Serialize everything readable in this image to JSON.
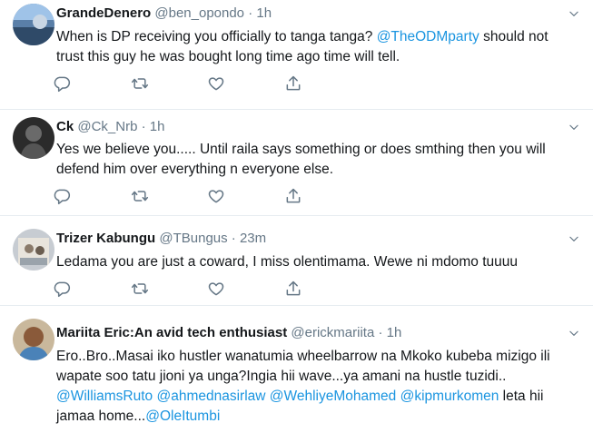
{
  "tweets": [
    {
      "name": "GrandeDenero",
      "handle": "@ben_opondo",
      "dot": "·",
      "time": "1h",
      "line1_pre": "When is DP receiving you officially to tanga tanga? ",
      "line1_mention": "@TheODMparty",
      "line1_post": "  should not",
      "line2": "trust this guy he was bought long time ago time will tell."
    },
    {
      "name": "Ck",
      "handle": "@Ck_Nrb",
      "dot": "·",
      "time": "1h",
      "line1": "Yes we believe you..... Until raila says something or does smthing then you will",
      "line2": "defend him over everything n everyone else."
    },
    {
      "name": "Trizer Kabungu",
      "handle": "@TBungus",
      "dot": "·",
      "time": "23m",
      "line1": "Ledama you are just a coward, I miss olentimama. Wewe ni mdomo tuuuu"
    },
    {
      "name": "Mariita Eric:An avid tech enthusiast",
      "handle": "@erickmariita",
      "dot": "·",
      "time": "1h",
      "line1": "Ero..Bro..Masai iko hustler wanatumia wheelbarrow na Mkoko kubeba mizigo ili",
      "line2": "wapate soo tatu jioni ya unga?Ingia hii wave...ya amani na hustle tuzidi..",
      "line3_mentions": [
        "@WilliamsRuto",
        "@ahmednasirlaw",
        "@WehliyeMohamed",
        "@kipmurkomen"
      ],
      "line3_post": " leta hii",
      "line4_pre": "jamaa home...",
      "line4_mention": "@OleItumbi"
    }
  ],
  "colors": {
    "text": "#14171a",
    "muted": "#657786",
    "link": "#1b95e0",
    "border": "#e6ecf0"
  },
  "icons": [
    "reply-icon",
    "retweet-icon",
    "like-icon",
    "share-icon",
    "chevron-down-icon"
  ]
}
